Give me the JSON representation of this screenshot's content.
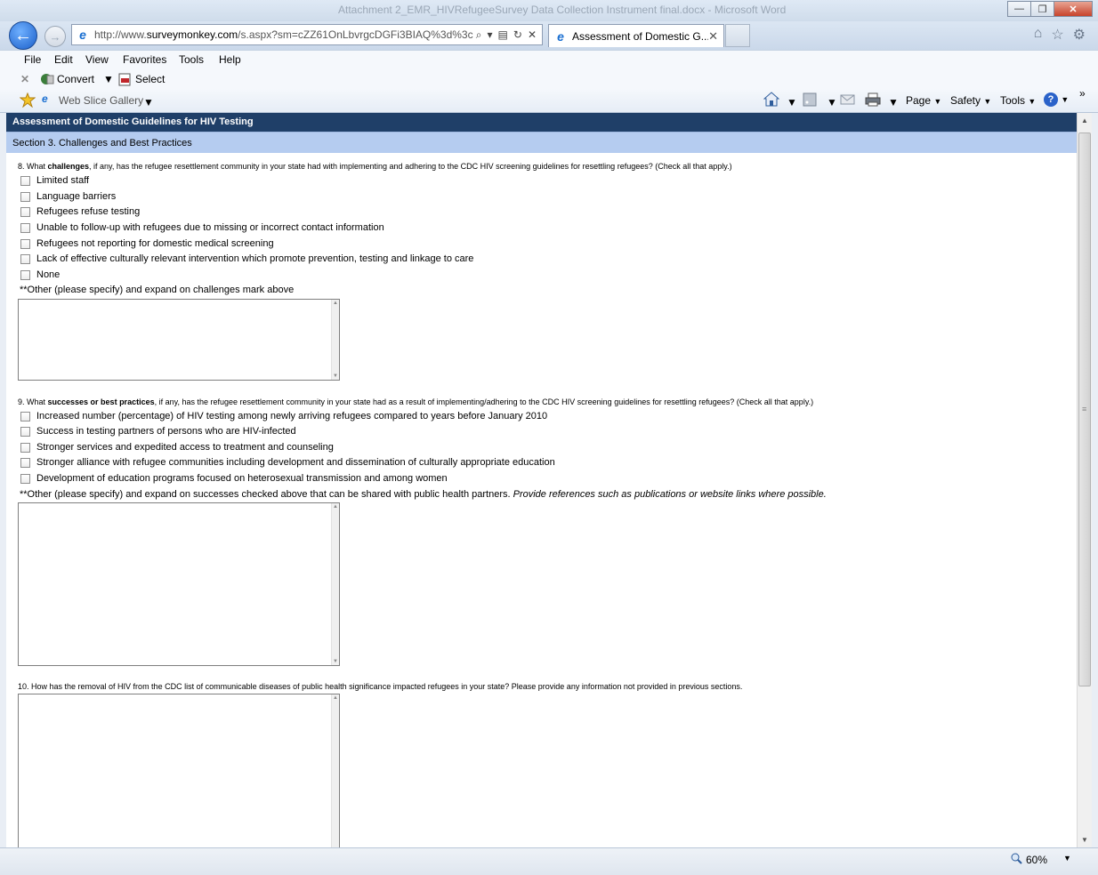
{
  "window": {
    "title": "Attachment 2_EMR_HIVRefugeeSurvey Data Collection Instrument final.docx - Microsoft Word",
    "minimize": "—",
    "maximize": "❐",
    "close": "✕"
  },
  "nav": {
    "back_glyph": "←",
    "forward_glyph": "→",
    "url_prefix": "http://www.",
    "url_domain": "surveymonkey.com",
    "url_rest": "/s.aspx?sm=cZZ61OnLbvrgcDGFi3BIAQ%3d%3c",
    "tab_title": "Assessment of Domestic G...",
    "tab_close": "✕",
    "home_glyph": "⌂",
    "star_glyph": "☆",
    "gear_glyph": "⚙"
  },
  "menu": [
    "File",
    "Edit",
    "View",
    "Favorites",
    "Tools",
    "Help"
  ],
  "convert_bar": {
    "close_glyph": "✕",
    "convert": "Convert",
    "select": "Select"
  },
  "command_bar": {
    "web_slice": "Web Slice Gallery",
    "page": "Page",
    "safety": "Safety",
    "tools": "Tools",
    "help_glyph": "?",
    "overflow": "»"
  },
  "survey": {
    "title": "Assessment of Domestic Guidelines for HIV Testing",
    "section": "Section 3. Challenges and Best Practices",
    "q8": {
      "prefix": "8. What ",
      "bold": "challenges",
      "rest": ", if any, has the refugee resettlement community in your state had with implementing and adhering to the CDC HIV screening guidelines for resettling refugees? (Check all that apply.)",
      "options": [
        "Limited staff",
        "Language barriers",
        "Refugees refuse testing",
        "Unable to follow-up with refugees due to missing or incorrect contact information",
        "Refugees not reporting for domestic medical screening",
        "Lack of effective culturally relevant intervention which promote prevention, testing and linkage to care",
        "None"
      ],
      "other_label": "**Other (please specify) and expand on challenges mark above"
    },
    "q9": {
      "prefix": "9. What ",
      "bold": "successes or best practices",
      "rest": ", if any, has the refugee resettlement community in your state had as a result of implementing/adhering to the CDC HIV screening guidelines for resettling refugees? (Check all that apply.)",
      "options": [
        "Increased number (percentage) of HIV testing among newly arriving refugees compared to years before January 2010",
        "Success in testing partners of persons who are HIV-infected",
        "Stronger services and expedited access to treatment and counseling",
        "Stronger alliance with refugee communities including development and dissemination of culturally appropriate education",
        "Development of education programs focused on heterosexual transmission and among women"
      ],
      "other_label": "**Other (please specify) and expand on successes checked above that can be shared with public health partners. ",
      "other_italic": "Provide references such as publications or website links where possible."
    },
    "q10": {
      "text": "10. How has the removal of HIV from the CDC list of communicable diseases of public health significance impacted refugees in your state? Please provide any information not provided in previous sections."
    }
  },
  "status": {
    "zoom": "60%"
  }
}
